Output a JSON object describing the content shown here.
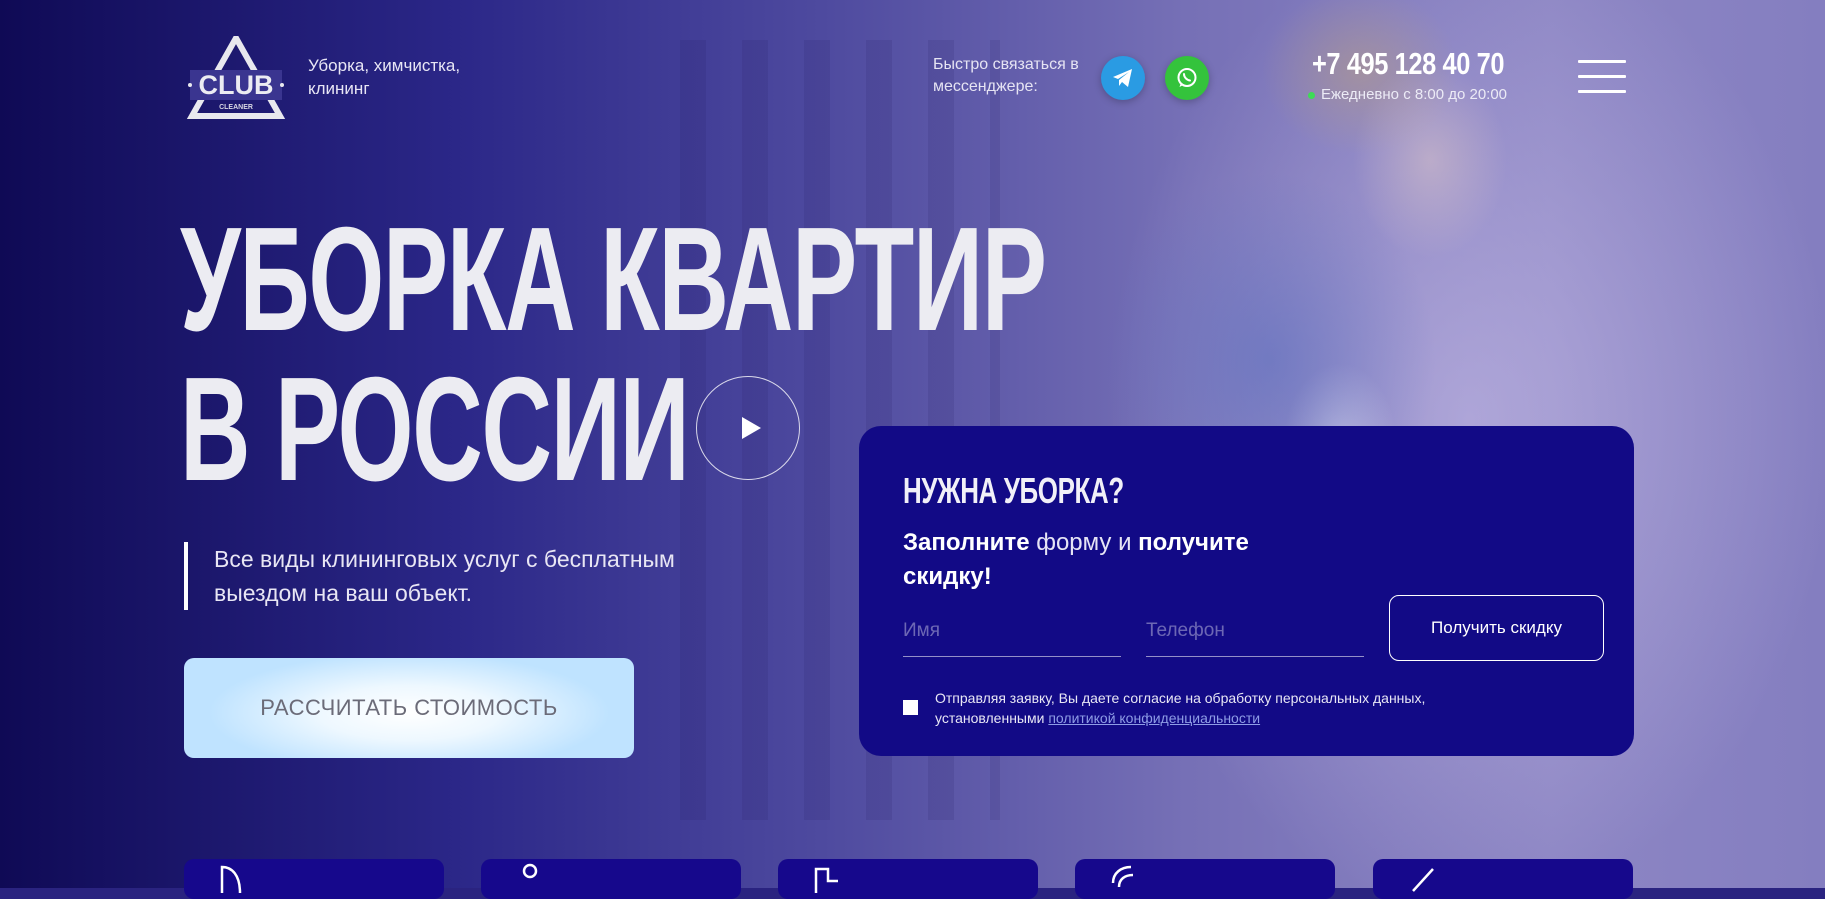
{
  "header": {
    "logo": {
      "text": "CLUB",
      "subtext": "CLEANER"
    },
    "tagline": "Уборка, химчистка, клининг",
    "contact_text": "Быстро связаться в мессенджере:",
    "messengers": [
      {
        "name": "telegram",
        "icon": "telegram-icon",
        "color": "#2a9be3"
      },
      {
        "name": "whatsapp",
        "icon": "whatsapp-icon",
        "color": "#34c33c"
      }
    ],
    "phone": "+7 495 128 40 70",
    "hours": "Ежедневно с 8:00 до 20:00",
    "menu_icon": "hamburger-menu-icon"
  },
  "hero": {
    "title_line1": "УБОРКА КВАРТИР",
    "title_line2": "В РОССИИ",
    "play_icon": "play-icon",
    "subtitle": "Все виды клининговых услуг с бесплатным выездом на ваш объект.",
    "cta_label": "РАССЧИТАТЬ СТОИМОСТЬ"
  },
  "form": {
    "title": "НУЖНА УБОРКА?",
    "subtitle_part1": "Заполните",
    "subtitle_part2": " форму и ",
    "subtitle_part3": "получите скидку!",
    "name_placeholder": "Имя",
    "phone_placeholder": "Телефон",
    "submit_label": "Получить скидку",
    "consent_text": "Отправляя заявку, Вы даете согласие на обработку персональных данных, установленными ",
    "consent_link": "политикой конфиденциальности"
  },
  "services": [
    {
      "icon": "service-icon-1"
    },
    {
      "icon": "service-icon-2"
    },
    {
      "icon": "service-icon-3"
    },
    {
      "icon": "service-icon-4"
    },
    {
      "icon": "service-icon-5"
    }
  ],
  "colors": {
    "background_dark": "#0f0a55",
    "form_card": "#120a86",
    "telegram": "#2a9be3",
    "whatsapp": "#34c33c",
    "status_dot": "#3ddc55"
  }
}
